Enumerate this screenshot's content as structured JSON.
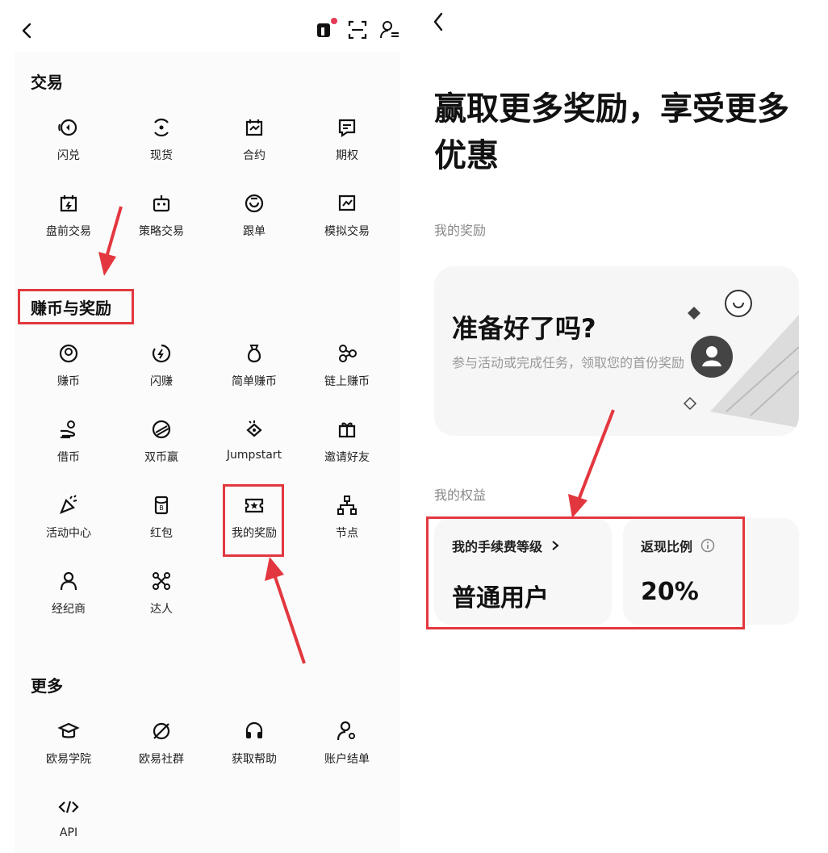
{
  "left": {
    "sections": {
      "trade": {
        "title": "交易",
        "items": [
          "闪兑",
          "现货",
          "合约",
          "期权",
          "盘前交易",
          "策略交易",
          "跟单",
          "模拟交易"
        ]
      },
      "earn": {
        "title": "赚币与奖励",
        "items": [
          "赚币",
          "闪赚",
          "简单赚币",
          "链上赚币",
          "借币",
          "双币赢",
          "Jumpstart",
          "邀请好友",
          "活动中心",
          "红包",
          "我的奖励",
          "节点",
          "经纪商",
          "达人"
        ]
      },
      "more": {
        "title": "更多",
        "items": [
          "欧易学院",
          "欧易社群",
          "获取帮助",
          "账户结单",
          "API"
        ]
      }
    },
    "icons": {
      "back": "chevron-left-icon",
      "notification": "notification-icon",
      "scan": "scan-icon",
      "account": "user-switch-icon"
    },
    "accent": "#e3373f"
  },
  "right": {
    "hero_title": "赢取更多奖励，享受更多优惠",
    "my_rewards_label": "我的奖励",
    "reward_card": {
      "title": "准备好了吗?",
      "desc": "参与活动或完成任务，领取您的首份奖励"
    },
    "my_benefits_label": "我的权益",
    "benefits": {
      "fee_level_label": "我的手续费等级",
      "fee_level_value": "普通用户",
      "rebate_label": "返现比例",
      "rebate_value": "20%"
    }
  }
}
